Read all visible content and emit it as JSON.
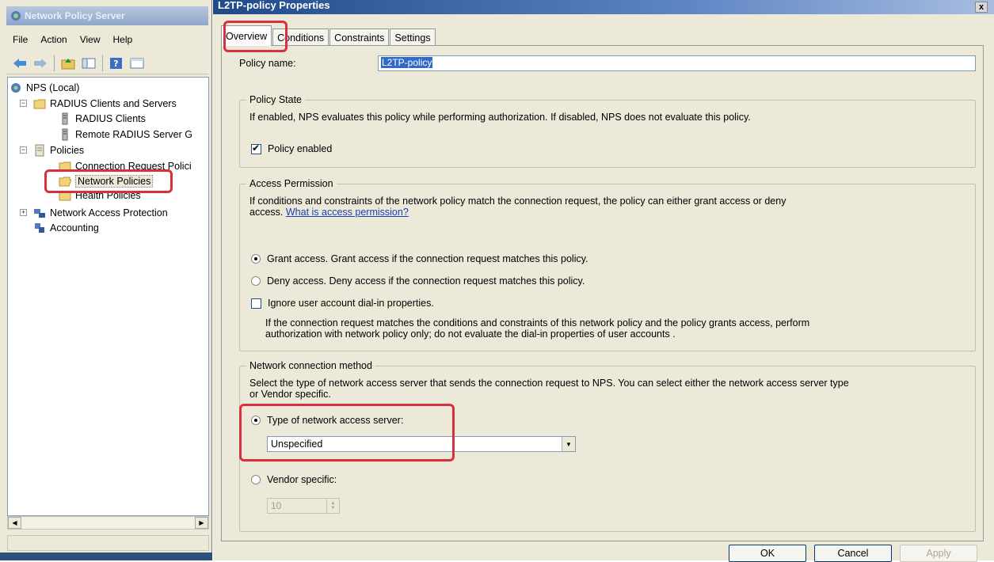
{
  "mmc": {
    "title": "Network Policy Server",
    "menu": [
      "File",
      "Action",
      "View",
      "Help"
    ],
    "toolbar_icons": [
      "back-icon",
      "forward-icon",
      "up-folder-icon",
      "show-hide-tree-icon",
      "help-icon",
      "properties-icon"
    ],
    "tree": {
      "root": "NPS (Local)",
      "radius_group": "RADIUS Clients and Servers",
      "radius_clients": "RADIUS Clients",
      "remote_radius": "Remote RADIUS Server G",
      "policies": "Policies",
      "connection_request": "Connection Request Polici",
      "network_policies": "Network Policies",
      "health_policies": "Health Policies",
      "nap": "Network Access Protection",
      "accounting": "Accounting"
    },
    "expanders": [
      "−",
      "−",
      "+"
    ]
  },
  "dialog": {
    "title": "L2TP-policy Properties",
    "close": "x",
    "tabs": [
      "Overview",
      "Conditions",
      "Constraints",
      "Settings"
    ],
    "policy_name_label": "Policy name:",
    "policy_name_value": "L2TP-policy",
    "policy_state": {
      "legend": "Policy State",
      "description": "If enabled, NPS evaluates this policy while performing authorization. If disabled, NPS does not evaluate this policy.",
      "enabled_label": "Policy enabled",
      "enabled": true
    },
    "access_permission": {
      "legend": "Access Permission",
      "description_line1": "If conditions and constraints of the network policy match the connection request, the policy can either grant access or deny",
      "description_line2": "access.",
      "link": "What is access permission?",
      "grant_label": "Grant access. Grant access if the connection request matches this policy.",
      "deny_label": "Deny access. Deny access if the connection request matches this policy.",
      "selected": "grant",
      "ignore_label": "Ignore user account dial-in properties.",
      "ignore_checked": false,
      "ignore_desc_line1": "If the connection request matches the conditions and constraints of this network policy and the policy grants access, perform",
      "ignore_desc_line2": "authorization with network policy only; do not evaluate the dial-in properties of user accounts ."
    },
    "connection_method": {
      "legend": "Network connection method",
      "description_line1": "Select the type of network access server that sends the connection request to NPS. You can select either the network access server type",
      "description_line2": "or Vendor specific.",
      "type_label": "Type of network access server:",
      "type_value": "Unspecified",
      "vendor_label": "Vendor specific:",
      "vendor_value": "10",
      "selected": "type"
    },
    "buttons": {
      "ok": "OK",
      "cancel": "Cancel",
      "apply": "Apply"
    }
  },
  "colors": {
    "highlight": "#d7303f",
    "title_bar": "#1f4a8a",
    "selection": "#316ac5"
  }
}
